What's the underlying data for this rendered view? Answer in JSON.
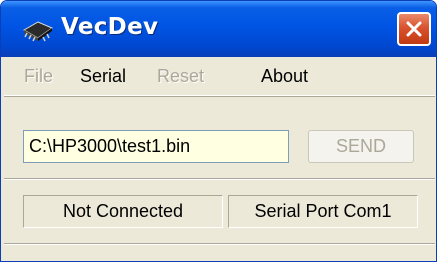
{
  "window": {
    "title": "VecDev",
    "icon": "chip-icon",
    "close_icon": "close-icon"
  },
  "menu": {
    "file": "File",
    "serial": "Serial",
    "reset": "Reset",
    "about": "About"
  },
  "form": {
    "path_value": "C:\\HP3000\\test1.bin",
    "send_label": "SEND"
  },
  "status": {
    "connection": "Not Connected",
    "port": "Serial Port Com1"
  },
  "colors": {
    "titlebar": "#0054e3",
    "close_button": "#d9532f",
    "field_background": "#ffffe1",
    "disabled_text": "#aca899"
  }
}
